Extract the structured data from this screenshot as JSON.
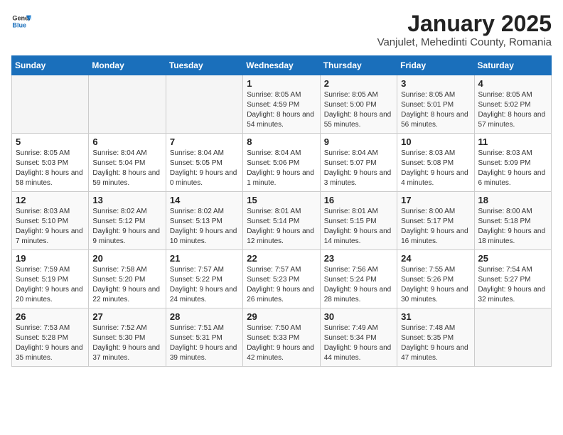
{
  "logo": {
    "general": "General",
    "blue": "Blue"
  },
  "title": "January 2025",
  "subtitle": "Vanjulet, Mehedinti County, Romania",
  "weekdays": [
    "Sunday",
    "Monday",
    "Tuesday",
    "Wednesday",
    "Thursday",
    "Friday",
    "Saturday"
  ],
  "weeks": [
    [
      {
        "day": "",
        "sunrise": "",
        "sunset": "",
        "daylight": ""
      },
      {
        "day": "",
        "sunrise": "",
        "sunset": "",
        "daylight": ""
      },
      {
        "day": "",
        "sunrise": "",
        "sunset": "",
        "daylight": ""
      },
      {
        "day": "1",
        "sunrise": "Sunrise: 8:05 AM",
        "sunset": "Sunset: 4:59 PM",
        "daylight": "Daylight: 8 hours and 54 minutes."
      },
      {
        "day": "2",
        "sunrise": "Sunrise: 8:05 AM",
        "sunset": "Sunset: 5:00 PM",
        "daylight": "Daylight: 8 hours and 55 minutes."
      },
      {
        "day": "3",
        "sunrise": "Sunrise: 8:05 AM",
        "sunset": "Sunset: 5:01 PM",
        "daylight": "Daylight: 8 hours and 56 minutes."
      },
      {
        "day": "4",
        "sunrise": "Sunrise: 8:05 AM",
        "sunset": "Sunset: 5:02 PM",
        "daylight": "Daylight: 8 hours and 57 minutes."
      }
    ],
    [
      {
        "day": "5",
        "sunrise": "Sunrise: 8:05 AM",
        "sunset": "Sunset: 5:03 PM",
        "daylight": "Daylight: 8 hours and 58 minutes."
      },
      {
        "day": "6",
        "sunrise": "Sunrise: 8:04 AM",
        "sunset": "Sunset: 5:04 PM",
        "daylight": "Daylight: 8 hours and 59 minutes."
      },
      {
        "day": "7",
        "sunrise": "Sunrise: 8:04 AM",
        "sunset": "Sunset: 5:05 PM",
        "daylight": "Daylight: 9 hours and 0 minutes."
      },
      {
        "day": "8",
        "sunrise": "Sunrise: 8:04 AM",
        "sunset": "Sunset: 5:06 PM",
        "daylight": "Daylight: 9 hours and 1 minute."
      },
      {
        "day": "9",
        "sunrise": "Sunrise: 8:04 AM",
        "sunset": "Sunset: 5:07 PM",
        "daylight": "Daylight: 9 hours and 3 minutes."
      },
      {
        "day": "10",
        "sunrise": "Sunrise: 8:03 AM",
        "sunset": "Sunset: 5:08 PM",
        "daylight": "Daylight: 9 hours and 4 minutes."
      },
      {
        "day": "11",
        "sunrise": "Sunrise: 8:03 AM",
        "sunset": "Sunset: 5:09 PM",
        "daylight": "Daylight: 9 hours and 6 minutes."
      }
    ],
    [
      {
        "day": "12",
        "sunrise": "Sunrise: 8:03 AM",
        "sunset": "Sunset: 5:10 PM",
        "daylight": "Daylight: 9 hours and 7 minutes."
      },
      {
        "day": "13",
        "sunrise": "Sunrise: 8:02 AM",
        "sunset": "Sunset: 5:12 PM",
        "daylight": "Daylight: 9 hours and 9 minutes."
      },
      {
        "day": "14",
        "sunrise": "Sunrise: 8:02 AM",
        "sunset": "Sunset: 5:13 PM",
        "daylight": "Daylight: 9 hours and 10 minutes."
      },
      {
        "day": "15",
        "sunrise": "Sunrise: 8:01 AM",
        "sunset": "Sunset: 5:14 PM",
        "daylight": "Daylight: 9 hours and 12 minutes."
      },
      {
        "day": "16",
        "sunrise": "Sunrise: 8:01 AM",
        "sunset": "Sunset: 5:15 PM",
        "daylight": "Daylight: 9 hours and 14 minutes."
      },
      {
        "day": "17",
        "sunrise": "Sunrise: 8:00 AM",
        "sunset": "Sunset: 5:17 PM",
        "daylight": "Daylight: 9 hours and 16 minutes."
      },
      {
        "day": "18",
        "sunrise": "Sunrise: 8:00 AM",
        "sunset": "Sunset: 5:18 PM",
        "daylight": "Daylight: 9 hours and 18 minutes."
      }
    ],
    [
      {
        "day": "19",
        "sunrise": "Sunrise: 7:59 AM",
        "sunset": "Sunset: 5:19 PM",
        "daylight": "Daylight: 9 hours and 20 minutes."
      },
      {
        "day": "20",
        "sunrise": "Sunrise: 7:58 AM",
        "sunset": "Sunset: 5:20 PM",
        "daylight": "Daylight: 9 hours and 22 minutes."
      },
      {
        "day": "21",
        "sunrise": "Sunrise: 7:57 AM",
        "sunset": "Sunset: 5:22 PM",
        "daylight": "Daylight: 9 hours and 24 minutes."
      },
      {
        "day": "22",
        "sunrise": "Sunrise: 7:57 AM",
        "sunset": "Sunset: 5:23 PM",
        "daylight": "Daylight: 9 hours and 26 minutes."
      },
      {
        "day": "23",
        "sunrise": "Sunrise: 7:56 AM",
        "sunset": "Sunset: 5:24 PM",
        "daylight": "Daylight: 9 hours and 28 minutes."
      },
      {
        "day": "24",
        "sunrise": "Sunrise: 7:55 AM",
        "sunset": "Sunset: 5:26 PM",
        "daylight": "Daylight: 9 hours and 30 minutes."
      },
      {
        "day": "25",
        "sunrise": "Sunrise: 7:54 AM",
        "sunset": "Sunset: 5:27 PM",
        "daylight": "Daylight: 9 hours and 32 minutes."
      }
    ],
    [
      {
        "day": "26",
        "sunrise": "Sunrise: 7:53 AM",
        "sunset": "Sunset: 5:28 PM",
        "daylight": "Daylight: 9 hours and 35 minutes."
      },
      {
        "day": "27",
        "sunrise": "Sunrise: 7:52 AM",
        "sunset": "Sunset: 5:30 PM",
        "daylight": "Daylight: 9 hours and 37 minutes."
      },
      {
        "day": "28",
        "sunrise": "Sunrise: 7:51 AM",
        "sunset": "Sunset: 5:31 PM",
        "daylight": "Daylight: 9 hours and 39 minutes."
      },
      {
        "day": "29",
        "sunrise": "Sunrise: 7:50 AM",
        "sunset": "Sunset: 5:33 PM",
        "daylight": "Daylight: 9 hours and 42 minutes."
      },
      {
        "day": "30",
        "sunrise": "Sunrise: 7:49 AM",
        "sunset": "Sunset: 5:34 PM",
        "daylight": "Daylight: 9 hours and 44 minutes."
      },
      {
        "day": "31",
        "sunrise": "Sunrise: 7:48 AM",
        "sunset": "Sunset: 5:35 PM",
        "daylight": "Daylight: 9 hours and 47 minutes."
      },
      {
        "day": "",
        "sunrise": "",
        "sunset": "",
        "daylight": ""
      }
    ]
  ]
}
